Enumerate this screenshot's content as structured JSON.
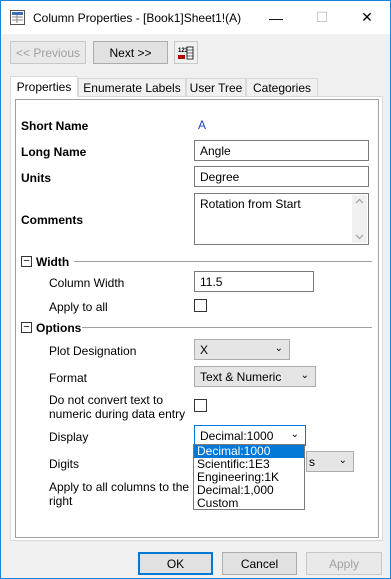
{
  "window": {
    "title": "Column Properties - [Book1]Sheet1!(A)",
    "minimize_glyph": "—",
    "maximize_glyph": "☐",
    "close_glyph": "✕"
  },
  "nav": {
    "previous_label": "<< Previous",
    "next_label": "Next >>",
    "tool_icon": "column-header-icon"
  },
  "tabs": [
    {
      "label": "Properties",
      "active": true
    },
    {
      "label": "Enumerate Labels",
      "active": false
    },
    {
      "label": "User Tree",
      "active": false
    },
    {
      "label": "Categories",
      "active": false
    }
  ],
  "properties": {
    "short_name_label": "Short Name",
    "short_name_value": "A",
    "long_name_label": "Long Name",
    "long_name_value": "Angle",
    "units_label": "Units",
    "units_value": "Degree",
    "comments_label": "Comments",
    "comments_value": "Rotation from Start"
  },
  "width_section": {
    "title": "Width",
    "toggle": "−",
    "column_width_label": "Column Width",
    "column_width_value": "11.5",
    "apply_to_all_label": "Apply to all"
  },
  "options_section": {
    "title": "Options",
    "toggle": "−",
    "plot_designation_label": "Plot Designation",
    "plot_designation_value": "X",
    "format_label": "Format",
    "format_value": "Text & Numeric",
    "no_convert_label_1": "Do not convert text to",
    "no_convert_label_2": "numeric during data entry",
    "display_label": "Display",
    "display_value": "Decimal:1000",
    "digits_label": "Digits",
    "apply_columns_label_1": "Apply to all columns to the",
    "apply_columns_label_2": "right"
  },
  "display_options": [
    "Decimal:1000",
    "Scientific:1E3",
    "Engineering:1K",
    "Decimal:1,000",
    "Custom"
  ],
  "footer": {
    "ok_label": "OK",
    "cancel_label": "Cancel",
    "apply_label": "Apply"
  },
  "colors": {
    "accent": "#0078d7",
    "short_name_color": "#1f3fbf"
  }
}
